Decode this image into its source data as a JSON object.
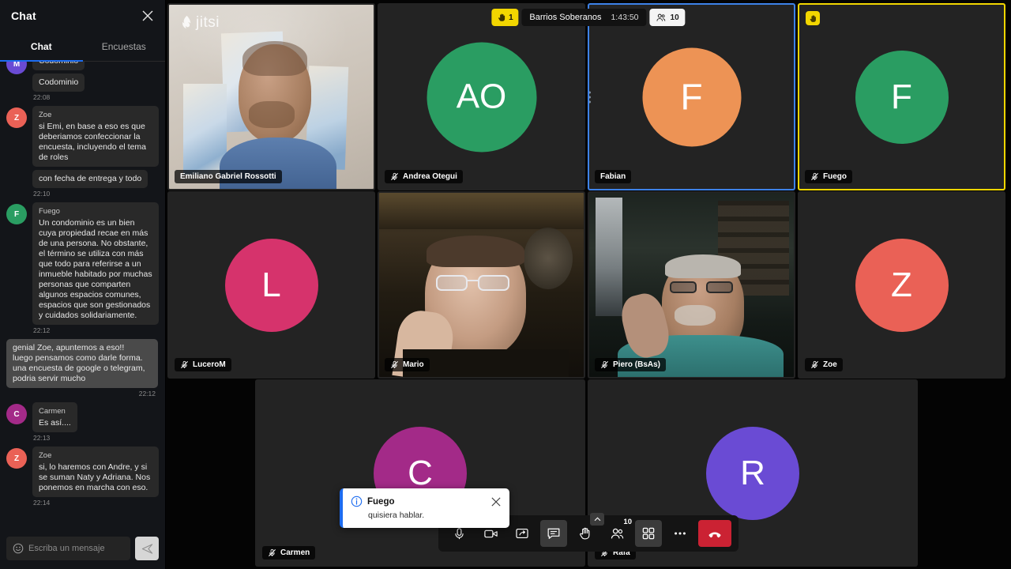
{
  "chat": {
    "header_title": "Chat",
    "close_icon": "close-icon",
    "tabs": [
      {
        "label": "Chat",
        "active": true
      },
      {
        "label": "Encuestas",
        "active": false
      }
    ],
    "messages": [
      {
        "sender": "M",
        "sender_name": "",
        "avatar_color": "#6A4BD4",
        "texts": [
          "Codominio",
          "Codominio"
        ],
        "timestamp": "22:08",
        "self": false,
        "show_sender_name": false
      },
      {
        "sender": "Z",
        "sender_name": "Zoe",
        "avatar_color": "#EA6156",
        "texts": [
          "si Emi, en base a eso es que deberiamos confeccionar la encuesta, incluyendo el tema de roles",
          "con fecha de entrega y todo"
        ],
        "timestamp": "22:10",
        "self": false,
        "show_sender_name": true
      },
      {
        "sender": "F",
        "sender_name": "Fuego",
        "avatar_color": "#2A9D62",
        "texts": [
          "Un condominio es un bien cuya propiedad recae en más de una persona. No obstante, el término se utiliza con más que todo para referirse a un inmueble habitado por muchas personas que comparten algunos espacios comunes, espacios que son gestionados y cuidados solidariamente."
        ],
        "timestamp": "22:12",
        "self": false,
        "show_sender_name": true
      },
      {
        "sender": "",
        "sender_name": "",
        "avatar_color": "",
        "texts": [
          "genial Zoe, apuntemos a eso!!\nluego pensamos como darle forma.\nuna encuesta de google o telegram,\npodria servir mucho"
        ],
        "timestamp": "22:12",
        "self": true,
        "show_sender_name": false
      },
      {
        "sender": "C",
        "sender_name": "Carmen",
        "avatar_color": "#A32A88",
        "texts": [
          "Es así...."
        ],
        "timestamp": "22:13",
        "self": false,
        "show_sender_name": true
      },
      {
        "sender": "Z",
        "sender_name": "Zoe",
        "avatar_color": "#EA6156",
        "texts": [
          "si, lo haremos con Andre, y si se suman Naty y Adriana. Nos ponemos en marcha con eso."
        ],
        "timestamp": "22:14",
        "self": false,
        "show_sender_name": true
      }
    ],
    "input_placeholder": "Escriba un mensaje",
    "emoji_icon": "smiley-icon",
    "send_icon": "send-icon"
  },
  "meeting": {
    "hand_raise_count": "1",
    "hand_icon": "raised-hand-icon",
    "name": "Barrios Soberanos",
    "timer": "1:43:50",
    "participant_count": "10",
    "participants_icon": "people-icon",
    "watermark": "jitsi"
  },
  "tiles": [
    {
      "name": "Emiliano Gabriel Rossotti",
      "type": "video",
      "muted": false,
      "selected": false,
      "hand": false,
      "avatar_letters": "",
      "avatar_color": "",
      "video_style": "person-lightwall"
    },
    {
      "name": "Andrea Otegui",
      "type": "avatar",
      "muted": true,
      "selected": false,
      "hand": false,
      "avatar_letters": "AO",
      "avatar_color": "#2A9D62",
      "video_style": ""
    },
    {
      "name": "Fabian",
      "type": "avatar",
      "muted": false,
      "selected": true,
      "hand": false,
      "avatar_letters": "F",
      "avatar_color": "#ED9355",
      "video_style": ""
    },
    {
      "name": "Fuego",
      "type": "avatar",
      "muted": true,
      "selected": false,
      "hand": true,
      "avatar_letters": "F",
      "avatar_color": "#2A9D62",
      "video_style": ""
    },
    {
      "name": "LuceroM",
      "type": "avatar",
      "muted": true,
      "selected": false,
      "hand": false,
      "avatar_letters": "L",
      "avatar_color": "#D6336C",
      "video_style": ""
    },
    {
      "name": "Mario",
      "type": "video",
      "muted": true,
      "selected": false,
      "hand": false,
      "avatar_letters": "",
      "avatar_color": "",
      "video_style": "person-darkroom"
    },
    {
      "name": "Piero (BsAs)",
      "type": "video",
      "muted": true,
      "selected": false,
      "hand": false,
      "avatar_letters": "",
      "avatar_color": "",
      "video_style": "person-teal"
    },
    {
      "name": "Zoe",
      "type": "avatar",
      "muted": true,
      "selected": false,
      "hand": false,
      "avatar_letters": "Z",
      "avatar_color": "#EA6156",
      "video_style": ""
    },
    {
      "name": "Carmen",
      "type": "avatar",
      "muted": true,
      "selected": false,
      "hand": false,
      "avatar_letters": "C",
      "avatar_color": "#A32A88",
      "video_style": ""
    },
    {
      "name": "Rafa",
      "type": "avatar",
      "muted": true,
      "selected": false,
      "hand": false,
      "avatar_letters": "R",
      "avatar_color": "#6A4BD4",
      "video_style": ""
    }
  ],
  "toolbar": {
    "buttons": [
      {
        "name": "microphone-button",
        "icon": "microphone-icon",
        "has_chevron": true,
        "toggled": false,
        "badge": ""
      },
      {
        "name": "camera-button",
        "icon": "camera-icon",
        "has_chevron": true,
        "toggled": false,
        "badge": ""
      },
      {
        "name": "screen-share-button",
        "icon": "screen-share-icon",
        "has_chevron": false,
        "toggled": false,
        "badge": ""
      },
      {
        "name": "chat-button",
        "icon": "chat-icon",
        "has_chevron": false,
        "toggled": true,
        "badge": ""
      },
      {
        "name": "raise-hand-button",
        "icon": "raised-hand-icon",
        "has_chevron": true,
        "toggled": false,
        "badge": ""
      },
      {
        "name": "participants-button",
        "icon": "people-icon",
        "has_chevron": false,
        "toggled": false,
        "badge": "10"
      },
      {
        "name": "tile-view-button",
        "icon": "tile-view-icon",
        "has_chevron": false,
        "toggled": true,
        "badge": ""
      },
      {
        "name": "more-options-button",
        "icon": "ellipsis-icon",
        "has_chevron": false,
        "toggled": false,
        "badge": ""
      },
      {
        "name": "hangup-button",
        "icon": "hangup-icon",
        "has_chevron": false,
        "toggled": false,
        "badge": ""
      }
    ]
  },
  "notification": {
    "icon": "info-icon",
    "title": "Fuego",
    "message": "quisiera hablar.",
    "close_icon": "close-icon"
  },
  "colors": {
    "accent_blue": "#1d6cf0",
    "hand_yellow": "#f2d600",
    "hangup_red": "#cb2233",
    "panel_bg": "#131519",
    "stage_bg": "#040404"
  }
}
